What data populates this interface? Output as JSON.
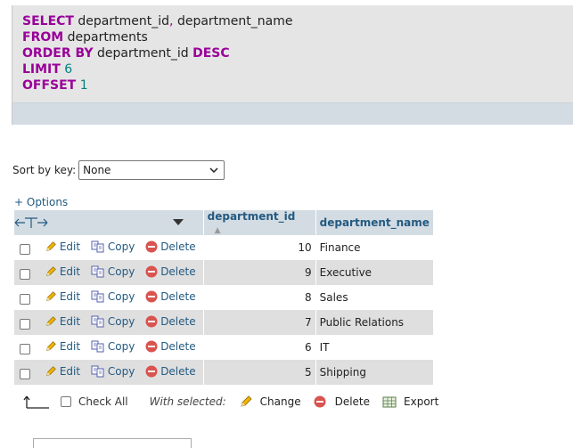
{
  "sql": {
    "line1_kw": "SELECT",
    "line1_col1": "department_id",
    "line1_comma": ",",
    "line1_col2": "department_name",
    "line2_kw": "FROM",
    "line2_table": "departments",
    "line3_kw": "ORDER BY",
    "line3_col": "department_id",
    "line3_dir": "DESC",
    "line4_kw": "LIMIT",
    "line4_num": "6",
    "line5_kw": "OFFSET",
    "line5_num": "1"
  },
  "sort": {
    "label": "Sort by key:",
    "selected": "None"
  },
  "options_link": "+ Options",
  "table": {
    "headers": [
      "department_id",
      "department_name"
    ],
    "action_labels": {
      "edit": "Edit",
      "copy": "Copy",
      "delete": "Delete"
    },
    "rows": [
      {
        "id": "10",
        "name": "Finance"
      },
      {
        "id": "9",
        "name": "Executive"
      },
      {
        "id": "8",
        "name": "Sales"
      },
      {
        "id": "7",
        "name": "Public Relations"
      },
      {
        "id": "6",
        "name": "IT"
      },
      {
        "id": "5",
        "name": "Shipping"
      }
    ]
  },
  "bottom": {
    "check_all": "Check All",
    "with_selected": "With selected:",
    "change": "Change",
    "delete": "Delete",
    "export": "Export"
  },
  "colors": {
    "link": "#235a81",
    "keyword": "#990099",
    "number": "#008080",
    "header_bg": "#d3dce3",
    "delete_red": "#d9534f"
  }
}
